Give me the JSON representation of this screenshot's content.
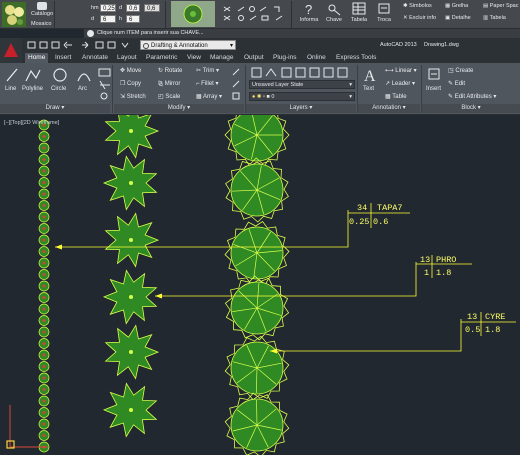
{
  "plugin_bar": {
    "catalogo_label": "Catálogo",
    "mosaico_label": "Mosaico",
    "dim_h_label": "h",
    "dim_h_value": "0,25",
    "dim_hm_label": "hm",
    "dim_d_label": "d",
    "dim_d_value": "6",
    "dim_a_value": "0,6",
    "dim_p_value": "0,6",
    "dim_v_value": "6",
    "informa_label": "Informa",
    "chave_label": "Chave",
    "tabela_label": "Tabela",
    "troca_label": "Troca",
    "simbolos_label": "Simbolos",
    "excluir_info_label": "Excluir info",
    "grelha_label": "Grelha",
    "detalhe_label": "Detalhe",
    "paper_space_label": "Paper Spac",
    "tabela2_label": "Tabela"
  },
  "hint": "Clique num ITEM para inserir sua CHAVE...",
  "title": {
    "workspace": "Drafting & Annotation",
    "app": "AutoCAD 2013",
    "file": "Drawing1.dwg"
  },
  "tabs": [
    "Home",
    "Insert",
    "Annotate",
    "Layout",
    "Parametric",
    "View",
    "Manage",
    "Output",
    "Plug-ins",
    "Online",
    "Express Tools"
  ],
  "ribbon": {
    "draw": {
      "title": "Draw",
      "line": "Line",
      "polyline": "Polyline",
      "circle": "Circle",
      "arc": "Arc"
    },
    "modify": {
      "title": "Modify",
      "move": "Move",
      "rotate": "Rotate",
      "trim": "Trim",
      "copy": "Copy",
      "mirror": "Mirror",
      "fillet": "Fillet",
      "stretch": "Stretch",
      "scale": "Scale",
      "array": "Array"
    },
    "layers": {
      "title": "Layers",
      "state": "Unsaved Layer State",
      "current": "0"
    },
    "annotation": {
      "title": "Annotation",
      "text": "Text",
      "linear": "Linear",
      "leader": "Leader",
      "table": "Table"
    },
    "block": {
      "title": "Block",
      "insert": "Insert",
      "create": "Create",
      "edit": "Edit",
      "edit_attributes": "Edit Attributes"
    }
  },
  "viewport_label": "[−][Top][2D Wireframe]",
  "tags": [
    {
      "qty": "34",
      "code": "TAPA7",
      "v1": "0.25",
      "v2": "0.6"
    },
    {
      "qty": "13",
      "code": "PHRO",
      "v1": "1",
      "v2": "1.8"
    },
    {
      "qty": "13",
      "code": "CYRE",
      "v1": "0.5",
      "v2": "1.8"
    }
  ],
  "colors": {
    "background": "#212830",
    "plant_fill": "#2f8a24",
    "plant_outline": "#d9ff4a",
    "tag_text": "#ffff66",
    "leader": "#ffff33"
  }
}
